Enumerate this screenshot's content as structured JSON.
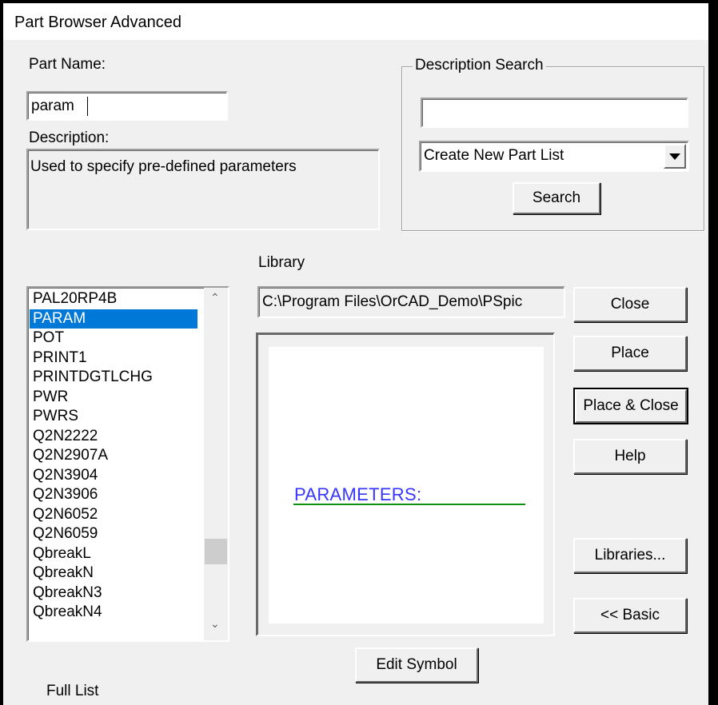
{
  "window": {
    "title": "Part Browser Advanced"
  },
  "part_name": {
    "label": "Part Name:",
    "value": "param"
  },
  "description": {
    "label": "Description:",
    "value": "Used to specify pre-defined parameters"
  },
  "description_search": {
    "group_label": "Description Search",
    "query_value": "",
    "mode_selected": "Create New Part List",
    "search_button": "Search"
  },
  "library": {
    "label": "Library",
    "path": "C:\\Program Files\\OrCAD_Demo\\PSpic"
  },
  "parts_list": {
    "items": [
      "PAL20RP4B",
      "PARAM",
      "POT",
      "PRINT1",
      "PRINTDGTLCHG",
      "PWR",
      "PWRS",
      "Q2N2222",
      "Q2N2907A",
      "Q2N3904",
      "Q2N3906",
      "Q2N6052",
      "Q2N6059",
      "QbreakL",
      "QbreakN",
      "QbreakN3",
      "QbreakN4"
    ],
    "selected": "PARAM",
    "scroll_up_icon": "chevron-up-icon",
    "scroll_down_icon": "chevron-down-icon"
  },
  "preview": {
    "symbol_text": "PARAMETERS:",
    "text_color": "#3535ff",
    "line_color": "#109010"
  },
  "buttons": {
    "close": "Close",
    "place": "Place",
    "place_close": "Place & Close",
    "help": "Help",
    "libraries": "Libraries...",
    "basic": "<< Basic",
    "edit_symbol": "Edit Symbol"
  },
  "footer": {
    "full_list_label": "Full List"
  },
  "colors": {
    "selection": "#0078d7",
    "dialog_bg": "#f0f0f0"
  }
}
